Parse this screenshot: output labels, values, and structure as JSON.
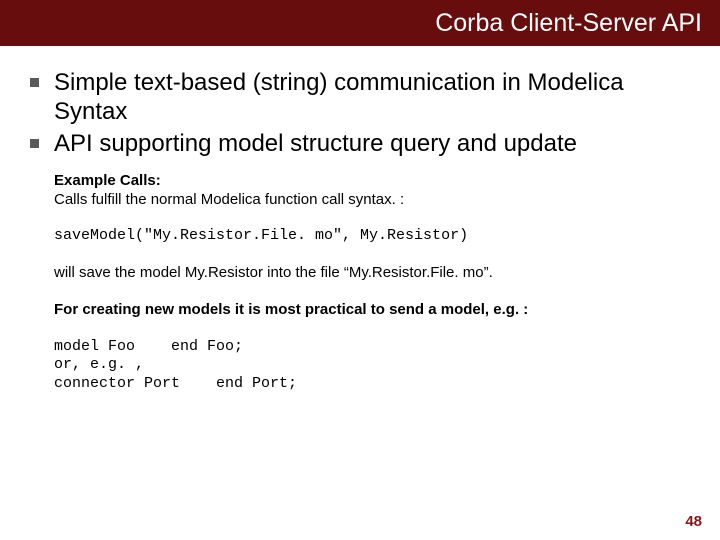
{
  "title": "Corba Client-Server API",
  "bullets": [
    "Simple text-based (string) communication in Modelica Syntax",
    "API supporting model structure query and update"
  ],
  "example_label": "Example Calls:",
  "example_desc": "Calls fulfill the normal Modelica function call syntax. :",
  "code1": "saveModel(\"My.Resistor.File. mo\", My.Resistor)",
  "save_note": "will save the model My.Resistor into the file “My.Resistor.File. mo”.",
  "create_note": "For creating new models it is most practical to send a model, e.g. :",
  "code2": "model Foo    end Foo;\nor, e.g. ,\nconnector Port    end Port;",
  "page_number": "48"
}
